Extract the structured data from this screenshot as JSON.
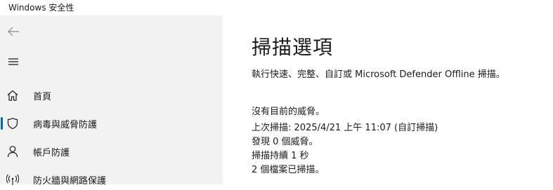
{
  "window": {
    "title": "Windows 安全性"
  },
  "sidebar": {
    "back_icon": "back-arrow-icon",
    "menu_icon": "hamburger-menu-icon",
    "items": [
      {
        "label": "首頁",
        "icon": "home-icon",
        "active": false
      },
      {
        "label": "病毒與威脅防護",
        "icon": "shield-icon",
        "active": true
      },
      {
        "label": "帳戶防護",
        "icon": "person-icon",
        "active": false
      },
      {
        "label": "防火牆與網路保護",
        "icon": "wifi-antenna-icon",
        "active": false
      }
    ]
  },
  "main": {
    "title": "掃描選項",
    "description": "執行快速、完整、自訂或 Microsoft Defender Offline 掃描。",
    "status": {
      "threats": "沒有目前的威脅。",
      "last_scan": "上次掃描: 2025/4/21 上午 11:07 (自訂掃描)",
      "found": "發現 0 個威脅。",
      "duration": "掃描持續 1 秒",
      "files": "2 個檔案已掃描。"
    }
  },
  "colors": {
    "sidebar_bg": "#f2f2f2",
    "accent": "#0067c0",
    "text": "#1a1a1a"
  }
}
